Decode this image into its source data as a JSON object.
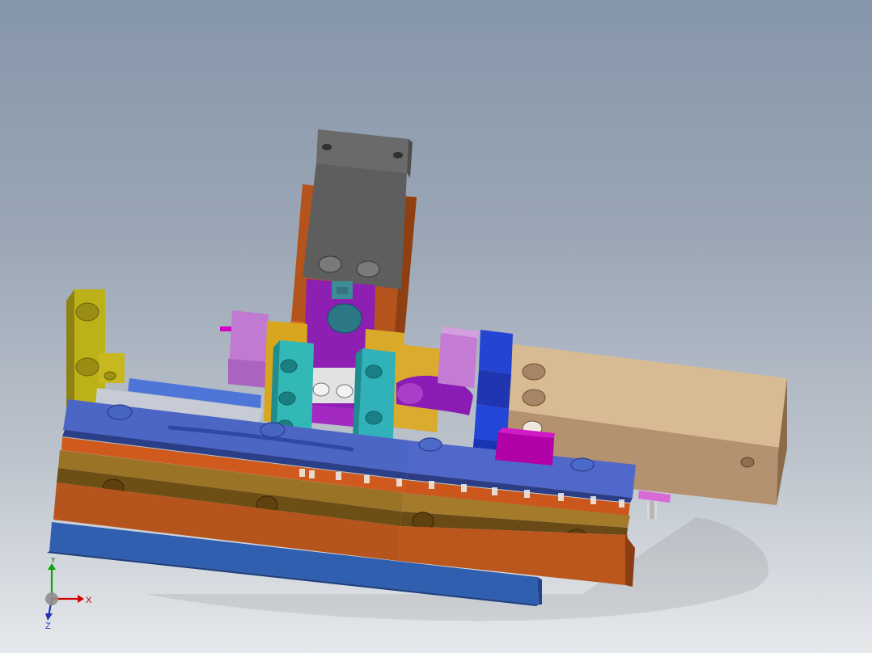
{
  "viewport": {
    "kind": "cad-3d-model-view"
  },
  "triad": {
    "x_label": "X",
    "y_label": "Y",
    "z_label": "Z"
  },
  "colors": {
    "background_top": "#8696aa",
    "background_bottom": "#e6e9ec",
    "gray_block": "#5f5f5f",
    "orange": "#b4541c",
    "purple": "#8d1fb3",
    "teal": "#31b4b7",
    "blue_plate": "#3d5bb3",
    "royal_blue": "#2444d3",
    "gold": "#d9a92a",
    "olive": "#b9a91d",
    "tan": "#c9ab85",
    "violet": "#c07ad1",
    "magenta": "#b100a7",
    "brown": "#6b4a1a",
    "bronze": "#9b7327",
    "blue_base": "#315fb0"
  }
}
